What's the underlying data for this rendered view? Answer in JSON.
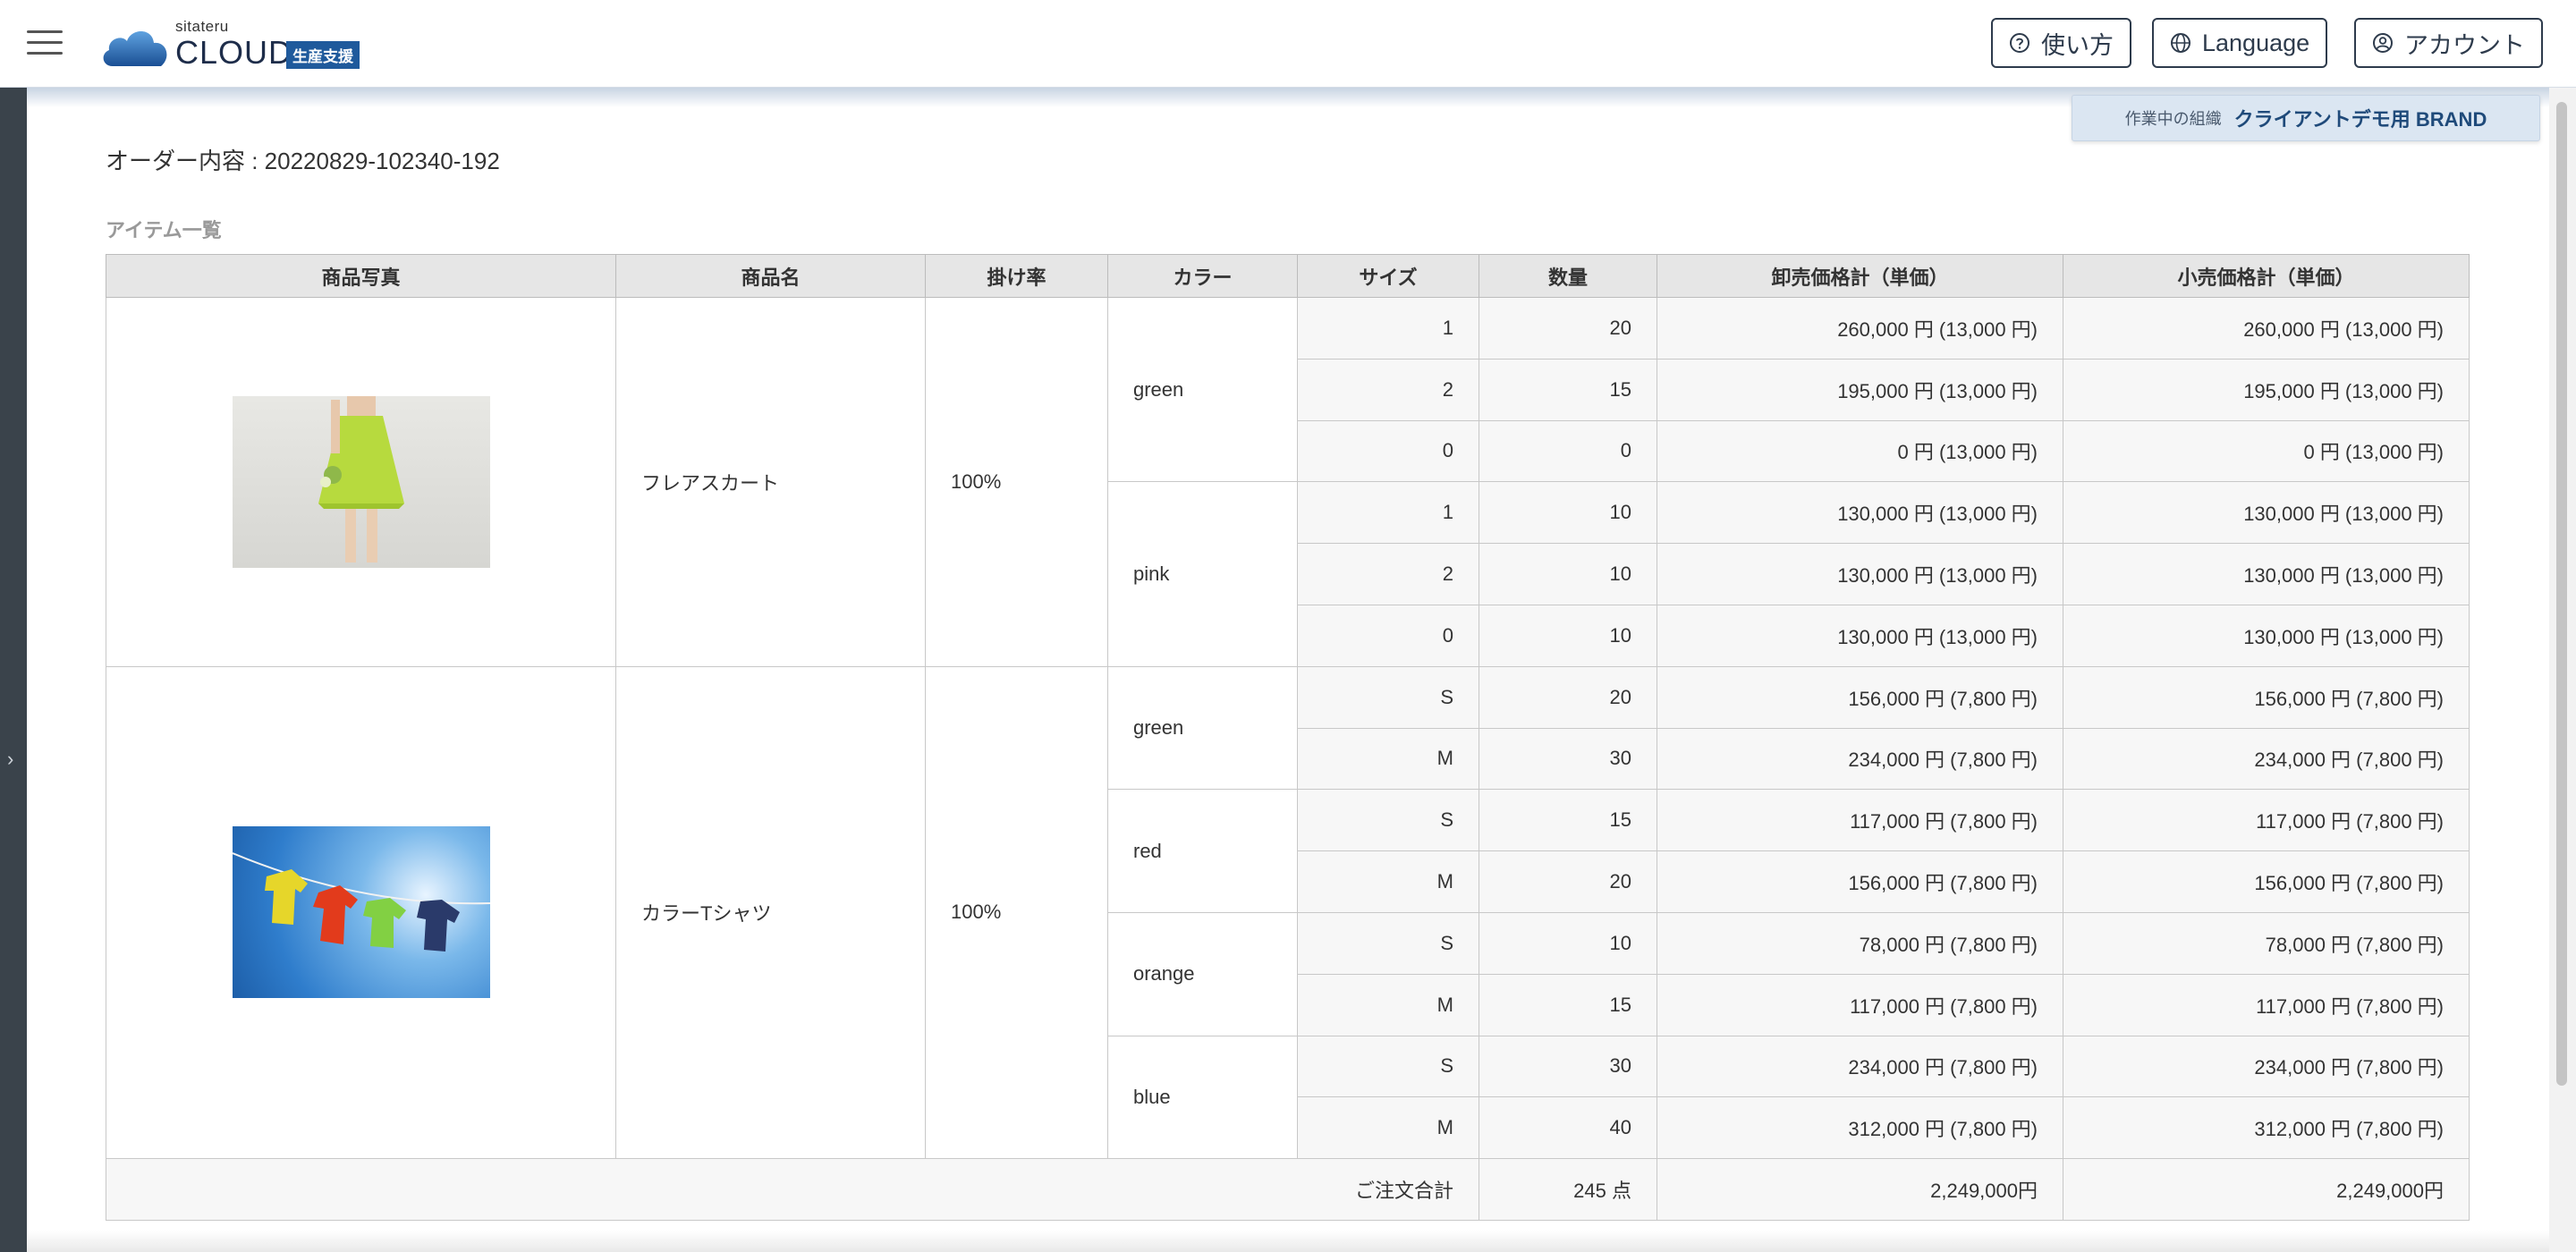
{
  "header": {
    "logo_small": "sitateru",
    "logo_main": "CLOUD",
    "logo_tag": "生産支援",
    "help_label": "使い方",
    "language_label": "Language",
    "account_label": "アカウント"
  },
  "org": {
    "label": "作業中の組織",
    "name": "クライアントデモ用 BRAND"
  },
  "order": {
    "title": "オーダー内容 : 20220829-102340-192",
    "section_title": "アイテム一覧"
  },
  "table": {
    "headers": [
      "商品写真",
      "商品名",
      "掛け率",
      "カラー",
      "サイズ",
      "数量",
      "卸売価格計（単価）",
      "小売価格計（単価）"
    ],
    "products": [
      {
        "name": "フレアスカート",
        "rate": "100%",
        "photo_icon": "skirt-photo",
        "colors": [
          {
            "color": "green",
            "rows": [
              {
                "size": "1",
                "qty": "20",
                "wholesale": "260,000 円 (13,000 円)",
                "retail": "260,000 円 (13,000 円)"
              },
              {
                "size": "2",
                "qty": "15",
                "wholesale": "195,000 円 (13,000 円)",
                "retail": "195,000 円 (13,000 円)"
              },
              {
                "size": "0",
                "qty": "0",
                "wholesale": "0 円 (13,000 円)",
                "retail": "0 円 (13,000 円)"
              }
            ]
          },
          {
            "color": "pink",
            "rows": [
              {
                "size": "1",
                "qty": "10",
                "wholesale": "130,000 円 (13,000 円)",
                "retail": "130,000 円 (13,000 円)"
              },
              {
                "size": "2",
                "qty": "10",
                "wholesale": "130,000 円 (13,000 円)",
                "retail": "130,000 円 (13,000 円)"
              },
              {
                "size": "0",
                "qty": "10",
                "wholesale": "130,000 円 (13,000 円)",
                "retail": "130,000 円 (13,000 円)"
              }
            ]
          }
        ]
      },
      {
        "name": "カラーTシャツ",
        "rate": "100%",
        "photo_icon": "tshirts-photo",
        "colors": [
          {
            "color": "green",
            "rows": [
              {
                "size": "S",
                "qty": "20",
                "wholesale": "156,000 円 (7,800 円)",
                "retail": "156,000 円 (7,800 円)"
              },
              {
                "size": "M",
                "qty": "30",
                "wholesale": "234,000 円 (7,800 円)",
                "retail": "234,000 円 (7,800 円)"
              }
            ]
          },
          {
            "color": "red",
            "rows": [
              {
                "size": "S",
                "qty": "15",
                "wholesale": "117,000 円 (7,800 円)",
                "retail": "117,000 円 (7,800 円)"
              },
              {
                "size": "M",
                "qty": "20",
                "wholesale": "156,000 円 (7,800 円)",
                "retail": "156,000 円 (7,800 円)"
              }
            ]
          },
          {
            "color": "orange",
            "rows": [
              {
                "size": "S",
                "qty": "10",
                "wholesale": "78,000 円 (7,800 円)",
                "retail": "78,000 円 (7,800 円)"
              },
              {
                "size": "M",
                "qty": "15",
                "wholesale": "117,000 円 (7,800 円)",
                "retail": "117,000 円 (7,800 円)"
              }
            ]
          },
          {
            "color": "blue",
            "rows": [
              {
                "size": "S",
                "qty": "30",
                "wholesale": "234,000 円 (7,800 円)",
                "retail": "234,000 円 (7,800 円)"
              },
              {
                "size": "M",
                "qty": "40",
                "wholesale": "312,000 円 (7,800 円)",
                "retail": "312,000 円 (7,800 円)"
              }
            ]
          }
        ]
      }
    ],
    "total": {
      "label": "ご注文合計",
      "qty": "245 点",
      "wholesale": "2,249,000円",
      "retail": "2,249,000円"
    }
  },
  "colors": {
    "accent": "#1f5a9c",
    "header_border": "#2e3b4c",
    "rail": "#3a434b",
    "org_bg": "#dbe6f2"
  }
}
